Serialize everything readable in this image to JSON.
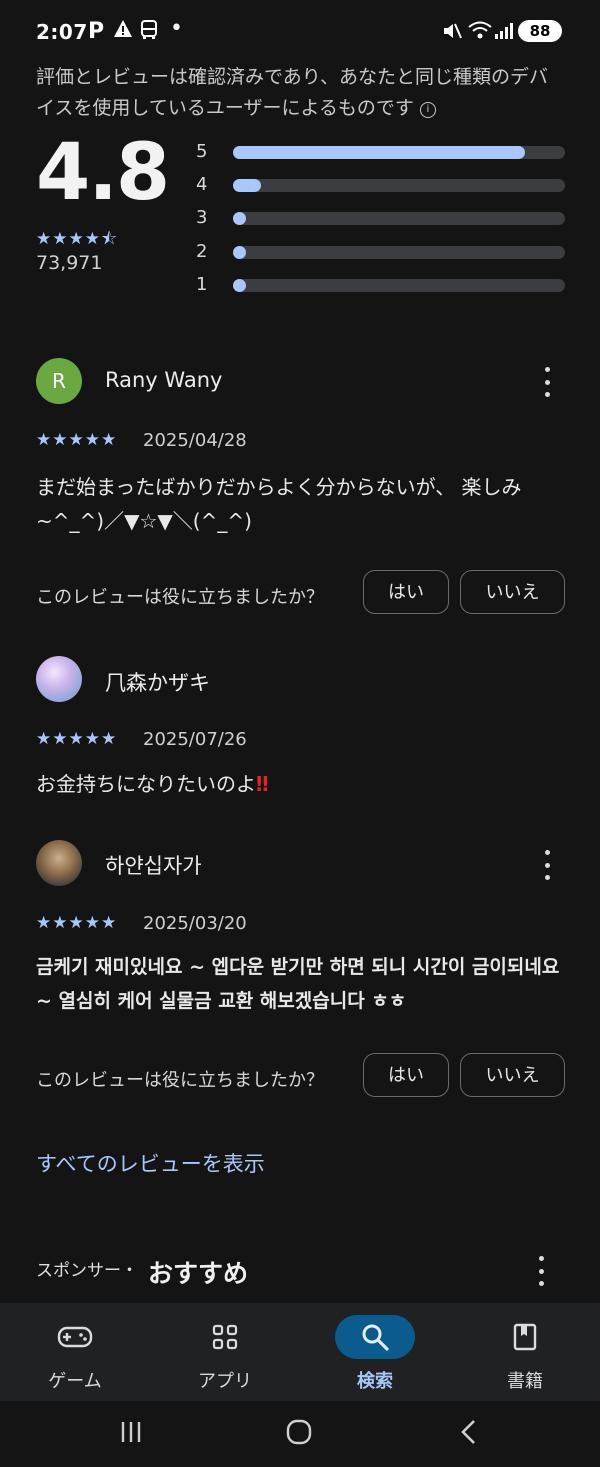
{
  "status_bar": {
    "time": "2:07",
    "battery": "88"
  },
  "ratings": {
    "info_text": "評価とレビューは確認済みであり、あなたと同じ種類のデバイスを使用しているユーザーによるものです",
    "average": "4.8",
    "stars_display": "★★★★⯪",
    "count": "73,971",
    "distribution": [
      {
        "label": "5",
        "fill": 0.88
      },
      {
        "label": "4",
        "fill": 0.085
      },
      {
        "label": "3",
        "fill": 0.04
      },
      {
        "label": "2",
        "fill": 0.04
      },
      {
        "label": "1",
        "fill": 0.04
      }
    ]
  },
  "reviews": [
    {
      "avatar_letter": "R",
      "name": "Rany Wany",
      "stars": "★★★★★",
      "date": "2025/04/28",
      "text": "まだ始まったばかりだからよく分からないが、 楽しみ~^_^)／▼☆▼＼(^_^)",
      "helpful_question": "このレビューは役に立ちましたか？",
      "yes": "はい",
      "no": "いいえ"
    },
    {
      "name": "⺇森かザキ",
      "stars": "★★★★★",
      "date": "2025/07/26",
      "text": "お金持ちになりたいのよ",
      "emoji": "‼"
    },
    {
      "name": "하얀십자가",
      "stars": "★★★★★",
      "date": "2025/03/20",
      "text": "금케기 재미있네요 ~ 엡다운 받기만 하면 되니 시간이 금이되네요 ~ 열심히 케어 실물금 교환 해보겠습니다 ㅎㅎ",
      "helpful_question": "このレビューは役に立ちましたか？",
      "yes": "はい",
      "no": "いいえ"
    }
  ],
  "see_all": "すべてのレビューを表示",
  "sponsored": {
    "label": "スポンサー・",
    "title": "おすすめ"
  },
  "bottom_nav": [
    {
      "label": "ゲーム",
      "icon": "gamepad-icon"
    },
    {
      "label": "アプリ",
      "icon": "apps-grid-icon"
    },
    {
      "label": "検索",
      "icon": "search-icon",
      "active": true
    },
    {
      "label": "書籍",
      "icon": "book-icon"
    }
  ],
  "colors": {
    "accent": "#a8c7fa",
    "background": "#141414",
    "active_pill": "#0b5b8f",
    "avatar_green": "#6aa842"
  }
}
